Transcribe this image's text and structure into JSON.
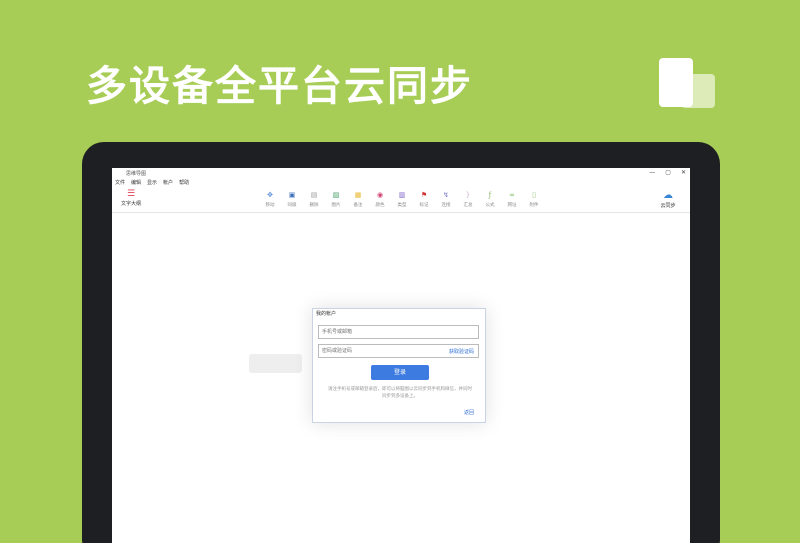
{
  "headline": "多设备全平台云同步",
  "app": {
    "title": "思维导图",
    "window_controls": [
      "—",
      "▢",
      "✕"
    ],
    "menu": [
      "文件",
      "编辑",
      "显示",
      "帐户",
      "帮助"
    ],
    "toc_tool": {
      "label": "文字大纲",
      "icon": "list-icon"
    },
    "tools": [
      {
        "label": "移动",
        "icon": "move-icon",
        "color": "#5a8fd8"
      },
      {
        "label": "同级",
        "icon": "sibling-node-icon",
        "color": "#3f6fb8"
      },
      {
        "label": "删除",
        "icon": "delete-icon",
        "color": "#9a9a9a"
      },
      {
        "label": "图片",
        "icon": "image-icon",
        "color": "#4aa06a"
      },
      {
        "label": "备注",
        "icon": "note-icon",
        "color": "#e8b830"
      },
      {
        "label": "颜色",
        "icon": "color-icon",
        "color": "#d04070"
      },
      {
        "label": "类型",
        "icon": "type-icon",
        "color": "#7a5ac8"
      },
      {
        "label": "标记",
        "icon": "flag-icon",
        "color": "#d03030"
      },
      {
        "label": "连接",
        "icon": "connect-icon",
        "color": "#7a7ad0"
      },
      {
        "label": "汇总",
        "icon": "summary-icon",
        "color": "#d0b0d0"
      },
      {
        "label": "公式",
        "icon": "formula-icon",
        "color": "#8ab86a"
      },
      {
        "label": "网址",
        "icon": "link-icon",
        "color": "#7ab85a"
      },
      {
        "label": "附件",
        "icon": "attachment-icon",
        "color": "#a0c880"
      }
    ],
    "cloud_tool": {
      "label": "云同步",
      "icon": "cloud-icon"
    },
    "login_dialog": {
      "title": "我的帐户",
      "phone_placeholder": "手机号或邮箱",
      "code_placeholder": "密码或验证码",
      "get_code": "获取验证码",
      "login_button": "登录",
      "hint": "请注手机号或邮箱登录后，即可以将脑图以云同步到手机和微信，并同时同步到多设备上。",
      "back": "返回"
    }
  }
}
